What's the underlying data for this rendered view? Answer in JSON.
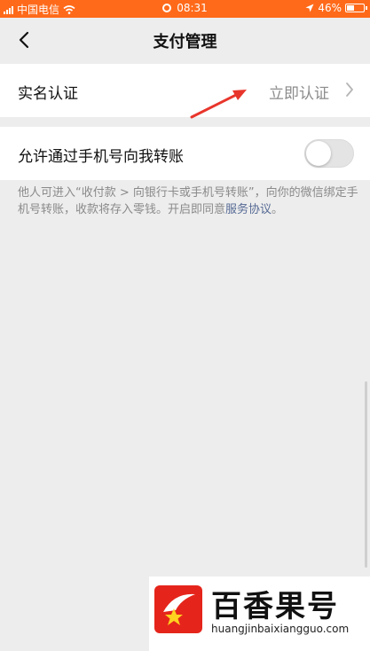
{
  "status_bar": {
    "carrier": "中国电信",
    "time": "08:31",
    "battery": "46%",
    "battery_level": 0.46
  },
  "nav": {
    "title": "支付管理"
  },
  "rows": {
    "real_name": {
      "label": "实名认证",
      "value": "立即认证"
    },
    "phone_transfer": {
      "label": "允许通过手机号向我转账",
      "toggle_on": false
    }
  },
  "note": {
    "text": "他人可进入“收付款 > 向银行卡或手机号转账”，向你的微信绑定手机号转账，收款将存入零钱。开启即同意",
    "link": "服务协议",
    "end": "。"
  },
  "watermark": {
    "title": "百香果号",
    "url": "huangjinbaixiangguo.com"
  },
  "colors": {
    "status_bar": "#ff6a1a",
    "annotation_arrow": "#e8352b",
    "link": "#576b95"
  }
}
